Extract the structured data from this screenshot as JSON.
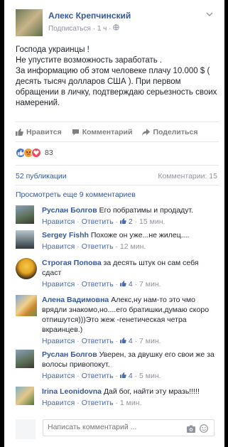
{
  "post": {
    "author": "Алекс Крепчинский",
    "subscribe": "Подписаться",
    "time": "1 ч",
    "text": [
      "Господа украинцы !",
      "Не упустите возможность заработать .",
      "За информацию об этом человеке плачу 10.000 $ ( десять тысяч долларов США ). При первом обращении в личку, подтверждаю серьезность своих намерений."
    ]
  },
  "actions": {
    "like": "Нравится",
    "comment": "Комментарий",
    "share": "Поделиться"
  },
  "reactions": {
    "count": "83",
    "types": [
      "like",
      "angry",
      "love"
    ]
  },
  "stats": {
    "shares": "52 публикации",
    "comments": "Комментарии: 15"
  },
  "more_comments": "Просмотреть еще 9 комментариев",
  "comments": [
    {
      "name": "Руслан Болгов",
      "text": "Его побратимы и продадут.",
      "like": "Нравится",
      "reply": "Ответить",
      "likes": "2",
      "time": "15 мин."
    },
    {
      "name": "Sergey Fishh",
      "text": "Похоже он уже...не жилец....",
      "like": "Нравится",
      "reply": "Ответить",
      "likes": "",
      "time": "12 мин."
    },
    {
      "name": "Строгая Попова",
      "text": "за десять штук он сам себя сдаст",
      "like": "Нравится",
      "reply": "Ответить",
      "likes": "4",
      "time": "7 мин."
    },
    {
      "name": "Алена Вадимовна",
      "text": "Алекс,ну нам-то это чмо врядли знакомо,но....его братишки,думаю скоро отпишутся)))Это жеж -генетическая четра вкраинцев.)",
      "like": "Нравится",
      "reply": "Ответить",
      "likes": "4",
      "time": "7 мин."
    },
    {
      "name": "Руслан Болгов",
      "text": "Уверен, за двушку его свои же за волосы привопокут.",
      "like": "Нравится",
      "reply": "Ответить",
      "likes": "4",
      "time": "5 мин."
    },
    {
      "name": "Irina Leonidovna",
      "text": "Дай бог, найти эту мразь!!!!!",
      "like": "Нравится",
      "reply": "Ответить",
      "likes": "",
      "time": "1 мин."
    }
  ],
  "reply_box": {
    "placeholder": "Написать комментарий ..."
  },
  "colors": {
    "link": "#365899",
    "muted": "#90949c",
    "like": "#4a76c9",
    "angry": "#f29b39",
    "love": "#f04a5c"
  }
}
